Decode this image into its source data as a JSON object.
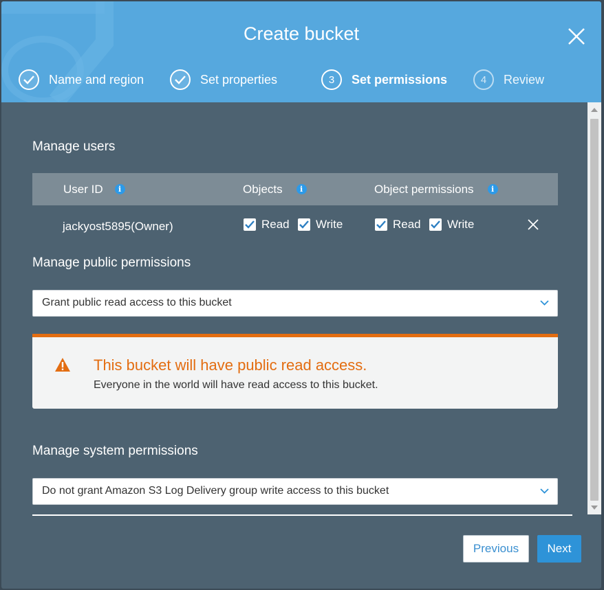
{
  "dialog": {
    "title": "Create bucket"
  },
  "steps": [
    {
      "number": "1",
      "label": "Name and region",
      "state": "complete"
    },
    {
      "number": "2",
      "label": "Set properties",
      "state": "complete"
    },
    {
      "number": "3",
      "label": "Set permissions",
      "state": "active"
    },
    {
      "number": "4",
      "label": "Review",
      "state": "upcoming"
    }
  ],
  "manage_users": {
    "title": "Manage users",
    "columns": [
      "User ID",
      "Objects",
      "Object permissions"
    ],
    "rows": [
      {
        "user": "jackyost5895(Owner)",
        "objects": {
          "read_label": "Read",
          "read": true,
          "write_label": "Write",
          "write": true
        },
        "object_permissions": {
          "read_label": "Read",
          "read": true,
          "write_label": "Write",
          "write": true
        }
      }
    ]
  },
  "public_permissions": {
    "title": "Manage public permissions",
    "selected": "Grant public read access to this bucket",
    "alert": {
      "title": "This bucket will have public read access.",
      "message": "Everyone in the world will have read access to this bucket."
    }
  },
  "system_permissions": {
    "title": "Manage system permissions",
    "selected": "Do not grant Amazon S3 Log Delivery group write access to this bucket"
  },
  "footer": {
    "previous_label": "Previous",
    "next_label": "Next"
  },
  "colors": {
    "header": "#56a8de",
    "body": "#4d6271",
    "warning": "#e36d11",
    "primary_button": "#2e93d8",
    "info_icon": "#2d9ae8"
  },
  "icons": {
    "close": "close-icon",
    "step_done": "check-circle-icon",
    "info": "info-icon",
    "checkbox": "checkbox-checked-icon",
    "remove": "close-icon",
    "select": "chevron-down-icon",
    "warning": "warning-triangle-icon"
  }
}
